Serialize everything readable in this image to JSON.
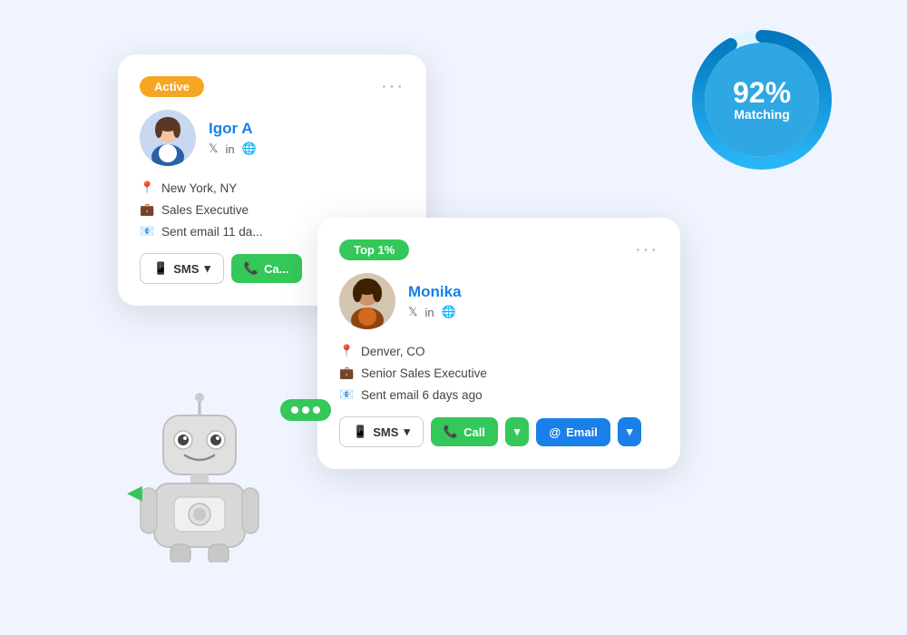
{
  "card1": {
    "badge": "Active",
    "more": "···",
    "name": "Igor A",
    "location": "New York, NY",
    "role": "Sales Executive",
    "activity": "Sent email 11 da...",
    "sms_label": "SMS",
    "call_label": "Ca..."
  },
  "card2": {
    "badge": "Top 1%",
    "more": "···",
    "name": "Monika",
    "location": "Denver, CO",
    "role": "Senior Sales Executive",
    "activity": "Sent email 6 days ago",
    "sms_label": "SMS",
    "call_label": "Call",
    "email_label": "Email"
  },
  "matching": {
    "percent": "92%",
    "label": "Matching"
  },
  "colors": {
    "active_badge": "#f5a623",
    "top_badge": "#34c759",
    "accent_blue": "#1a7fe8",
    "call_green": "#34c759"
  }
}
